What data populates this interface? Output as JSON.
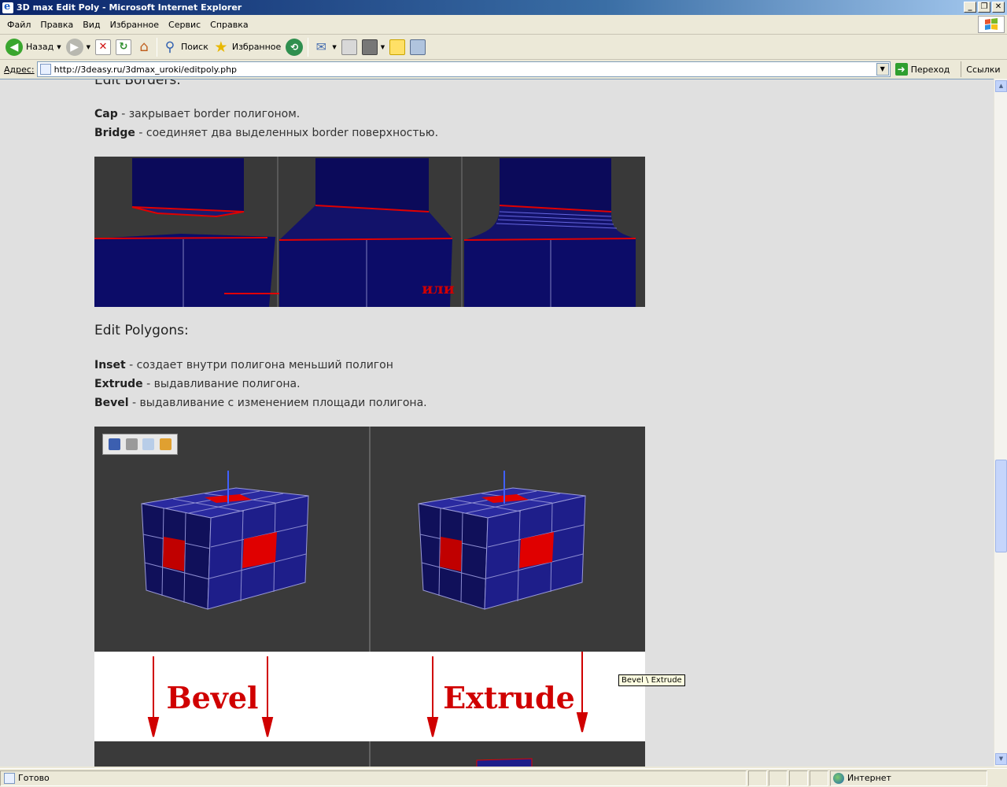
{
  "window": {
    "title": "3D max Edit Poly - Microsoft Internet Explorer",
    "controls": [
      "_",
      "❐",
      "✕"
    ]
  },
  "menu": [
    "Файл",
    "Правка",
    "Вид",
    "Избранное",
    "Сервис",
    "Справка"
  ],
  "toolbar": {
    "back_label": "Назад",
    "search_label": "Поиск",
    "favorites_label": "Избранное"
  },
  "address": {
    "label": "Адрес:",
    "url": "http://3deasy.ru/3dmax_uroki/editpoly.php",
    "go_label": "Переход",
    "links_label": "Ссылки"
  },
  "page": {
    "borders_heading": "Edit Borders:",
    "borders_items": [
      {
        "term": "Cap",
        "desc": " - закрывает border полигоном."
      },
      {
        "term": "Bridge",
        "desc": " - соединяет два выделенных border поверхностью."
      }
    ],
    "borders_image_label": "или",
    "polygons_heading": "Edit Polygons:",
    "polygons_items": [
      {
        "term": "Inset",
        "desc": " - создает внутри полигона меньший полигон"
      },
      {
        "term": "Extrude",
        "desc": " - выдавливание полигона."
      },
      {
        "term": "Bevel",
        "desc": " - выдавливание с изменением площади полигона."
      }
    ],
    "polygons_image_labels": {
      "left": "Bevel",
      "right": "Extrude"
    },
    "tooltip": "Bevel \\ Extrude"
  },
  "status": {
    "text": "Готово",
    "zone": "Интернет"
  },
  "colors": {
    "model_blue": "#191a7a",
    "selection_red": "#e20000",
    "viewport_bg": "#3a3a3a",
    "page_bg": "#e0e0e0"
  }
}
